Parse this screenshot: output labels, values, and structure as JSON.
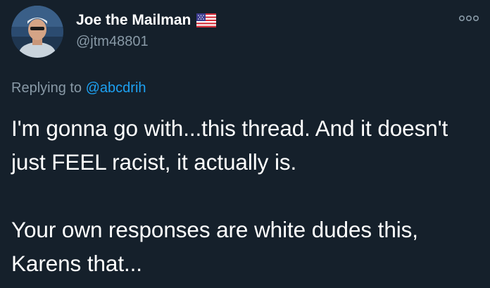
{
  "author": {
    "display_name": "Joe the Mailman",
    "handle": "@jtm48801",
    "flag_icon": "us-flag-icon",
    "avatar_icon": "profile-avatar"
  },
  "reply": {
    "prefix": "Replying to ",
    "to_handle": "@abcdrih"
  },
  "tweet": {
    "text": "I'm gonna go with...this thread. And it doesn't just FEEL racist, it actually is.\n\nYour own responses are white dudes this, Karens  that..."
  },
  "colors": {
    "background": "#15202b",
    "text_primary": "#ffffff",
    "text_secondary": "#8899a6",
    "link": "#1da1f2"
  },
  "menu": {
    "more_icon": "more-options-icon"
  }
}
